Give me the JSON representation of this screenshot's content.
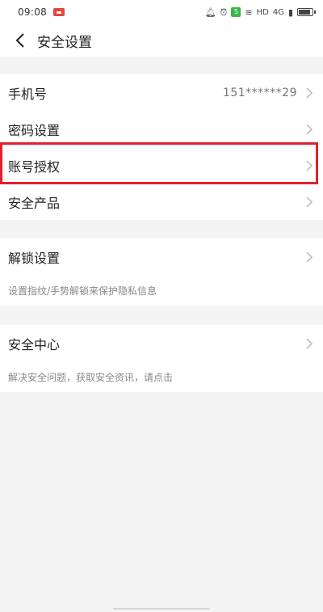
{
  "status_bar": {
    "time": "09:08",
    "network_label": "HD",
    "signal_label": "4G",
    "colors": {
      "notification": "#e8453c",
      "green_badge": "#3bb54a"
    }
  },
  "header": {
    "title": "安全设置",
    "back_icon": "chevron-left-icon"
  },
  "account_section": {
    "items": [
      {
        "label": "手机号",
        "value": "151******29"
      },
      {
        "label": "密码设置"
      },
      {
        "label": "账号授权",
        "highlighted": true
      },
      {
        "label": "安全产品"
      }
    ]
  },
  "unlock_section": {
    "label": "解锁设置",
    "description": "设置指纹/手势解锁来保护隐私信息"
  },
  "security_center_section": {
    "label": "安全中心",
    "description": "解决安全问题，获取安全资讯，请点击"
  },
  "colors": {
    "highlight_border": "#e2202b",
    "background": "#f4f4f4"
  }
}
